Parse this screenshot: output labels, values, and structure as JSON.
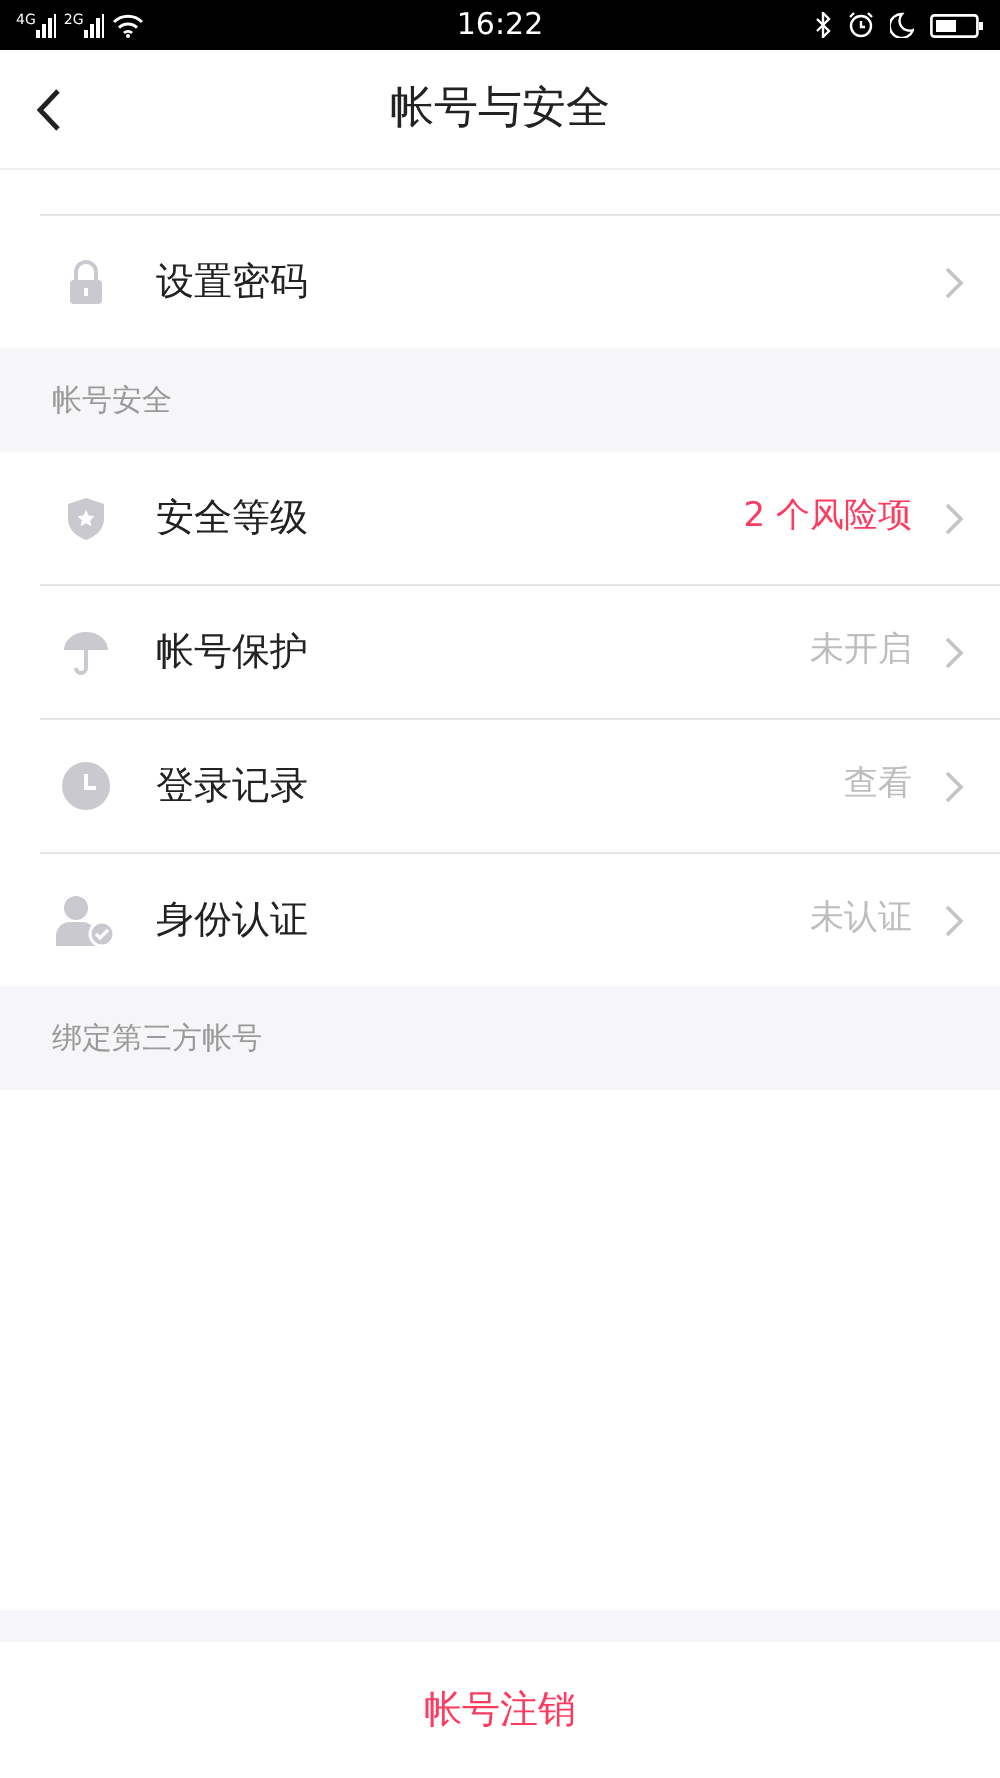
{
  "status_bar": {
    "network_labels": [
      "4G",
      "2G"
    ],
    "time": "16:22"
  },
  "header": {
    "title": "帐号与安全"
  },
  "sections": [
    {
      "items": [
        {
          "label": "设置密码"
        }
      ]
    },
    {
      "title": "帐号安全",
      "items": [
        {
          "label": "安全等级",
          "value": "2 个风险项",
          "kind": "alert"
        },
        {
          "label": "帐号保护",
          "value": "未开启",
          "kind": "plain"
        },
        {
          "label": "登录记录",
          "value": "查看",
          "kind": "plain"
        },
        {
          "label": "身份认证",
          "value": "未认证",
          "kind": "plain"
        }
      ]
    },
    {
      "title": "绑定第三方帐号"
    }
  ],
  "footer": {
    "action": "帐号注销"
  }
}
